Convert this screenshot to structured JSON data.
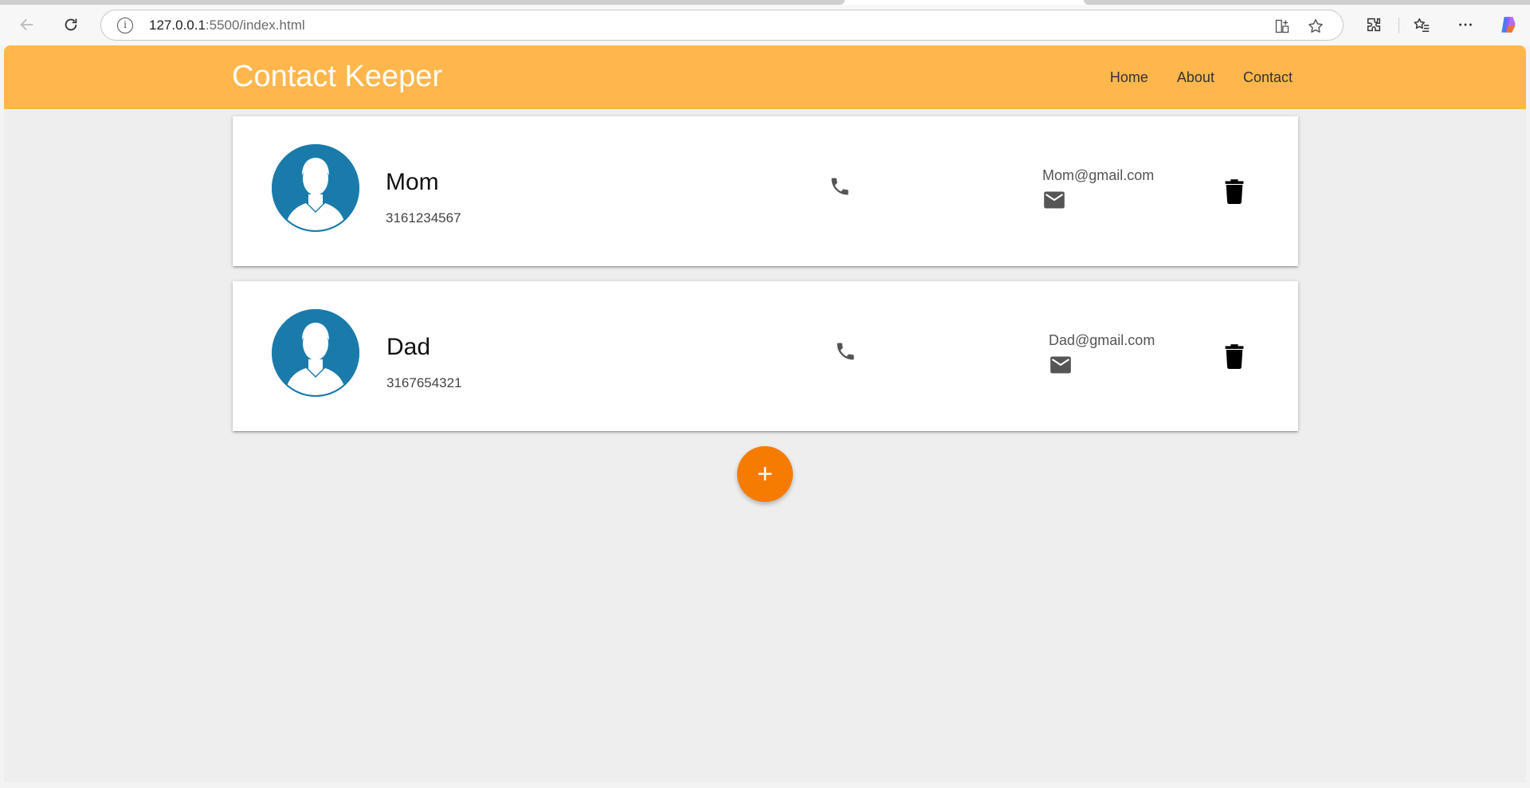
{
  "browser": {
    "url_host": "127.0.0.1",
    "url_rest": ":5500/index.html"
  },
  "navbar": {
    "brand": "Contact Keeper",
    "links": [
      "Home",
      "About",
      "Contact"
    ]
  },
  "contacts": [
    {
      "name": "Mom",
      "phone": "3161234567",
      "email": "Mom@gmail.com"
    },
    {
      "name": "Dad",
      "phone": "3167654321",
      "email": "Dad@gmail.com"
    }
  ],
  "fab": {
    "label": "+"
  },
  "colors": {
    "navbar": "#ffb74d",
    "fab": "#f57c00",
    "avatar": "#1a7bab"
  },
  "icons": {
    "back": "arrow-left-icon",
    "reload": "reload-icon",
    "info": "info-icon",
    "phone": "phone-icon",
    "email": "mail-icon",
    "delete": "trash-icon"
  }
}
